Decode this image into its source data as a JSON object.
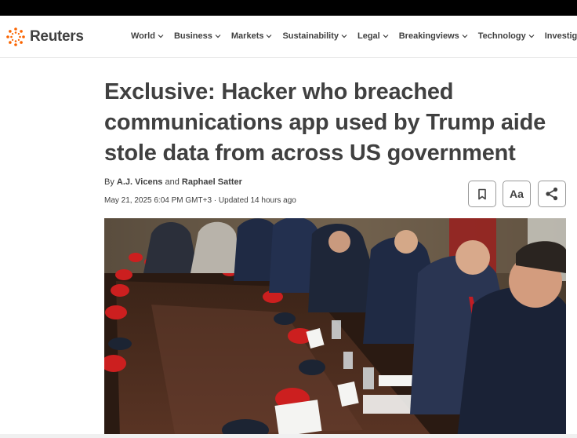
{
  "brand": {
    "name": "Reuters"
  },
  "nav": {
    "items": [
      {
        "label": "World"
      },
      {
        "label": "Business"
      },
      {
        "label": "Markets"
      },
      {
        "label": "Sustainability"
      },
      {
        "label": "Legal"
      },
      {
        "label": "Breakingviews"
      },
      {
        "label": "Technology"
      },
      {
        "label": "Investigatio"
      }
    ]
  },
  "article": {
    "headline": "Exclusive: Hacker who breached communications app used by Trump aide stole data from across US government",
    "byline_prefix": "By",
    "author1": "A.J. Vicens",
    "byline_and": "and",
    "author2": "Raphael Satter",
    "date": "May 21, 2025 6:04 PM GMT+3",
    "updated": "· Updated 14 hours ago",
    "textsize_label": "Aa"
  },
  "icons": {
    "bookmark": "bookmark-icon",
    "share": "share-icon",
    "chevron": "chevron-down-icon"
  },
  "colors": {
    "text": "#404040",
    "brand_orange": "#fa6400",
    "topbar": "#000000"
  }
}
